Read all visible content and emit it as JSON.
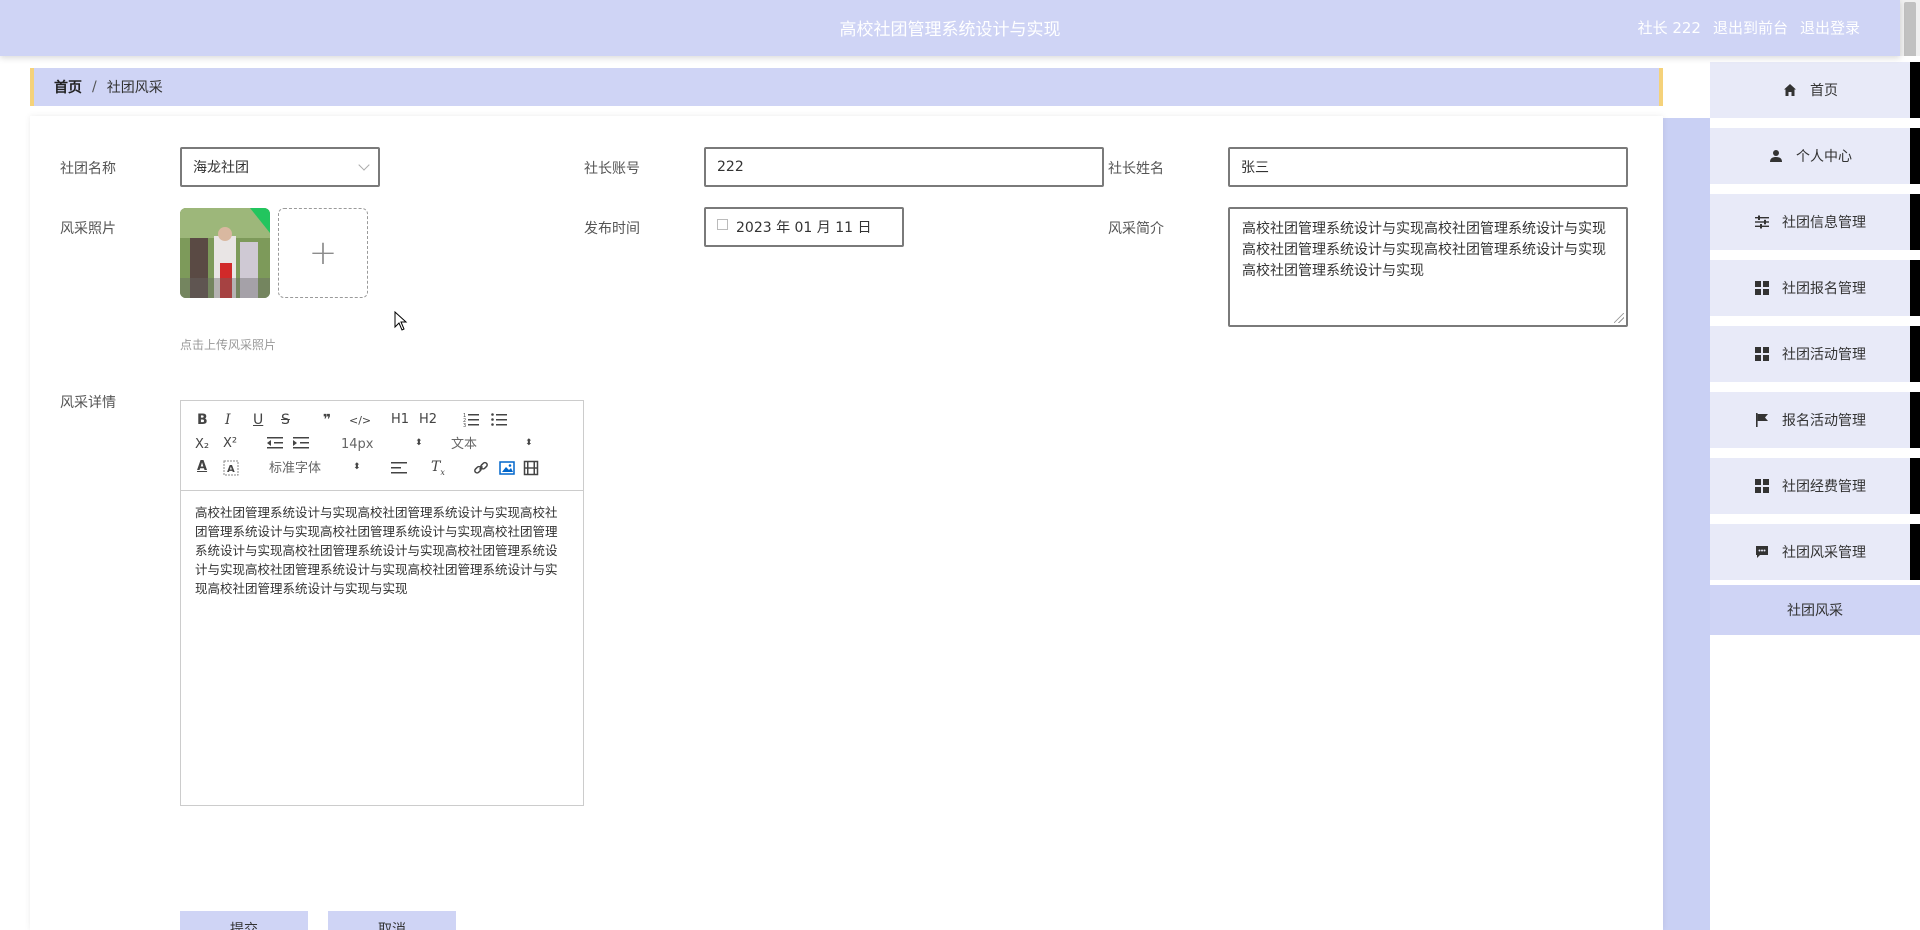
{
  "header": {
    "title": "高校社团管理系统设计与实现",
    "user_label": "社长 222",
    "back_label": "退出到前台",
    "logout_label": "退出登录"
  },
  "breadcrumb": {
    "home": "首页",
    "separator": "/",
    "current": "社团风采"
  },
  "form": {
    "club_name_label": "社团名称",
    "club_name_value": "海龙社团",
    "leader_account_label": "社长账号",
    "leader_account_value": "222",
    "leader_name_label": "社长姓名",
    "leader_name_value": "张三",
    "photo_label": "风采照片",
    "photo_hint": "点击上传风采照片",
    "publish_time_label": "发布时间",
    "publish_time_value": "2023 年 01 月 11 日",
    "intro_label": "风采简介",
    "intro_value": "高校社团管理系统设计与实现高校社团管理系统设计与实现高校社团管理系统设计与实现高校社团管理系统设计与实现高校社团管理系统设计与实现",
    "detail_label": "风采详情",
    "detail_value": "高校社团管理系统设计与实现高校社团管理系统设计与实现高校社团管理系统设计与实现高校社团管理系统设计与实现高校社团管理系统设计与实现高校社团管理系统设计与实现高校社团管理系统设计与实现高校社团管理系统设计与实现高校社团管理系统设计与实现高校社团管理系统设计与实现与实现",
    "submit_label": "提交",
    "cancel_label": "取消"
  },
  "editor_toolbar": {
    "bold": "B",
    "italic": "I",
    "underline": "U",
    "strike": "S",
    "quote": "❞",
    "code": "</>",
    "h1": "H1",
    "h2": "H2",
    "subscript": "X₂",
    "superscript": "X²",
    "size_value": "14px",
    "header_value": "文本",
    "font_value": "标准字体"
  },
  "sidebar": {
    "items": [
      {
        "label": "首页",
        "icon": "home-icon"
      },
      {
        "label": "个人中心",
        "icon": "user-icon"
      },
      {
        "label": "社团信息管理",
        "icon": "sliders-icon"
      },
      {
        "label": "社团报名管理",
        "icon": "grid-icon"
      },
      {
        "label": "社团活动管理",
        "icon": "grid-icon"
      },
      {
        "label": "报名活动管理",
        "icon": "flag-icon"
      },
      {
        "label": "社团经费管理",
        "icon": "grid-icon"
      },
      {
        "label": "社团风采管理",
        "icon": "comment-icon"
      }
    ],
    "sub_item": "社团风采"
  },
  "colors": {
    "accent": "#cfd4f5",
    "breadcrumb_border": "#f5d27a",
    "sidebar_item_bg": "#e8eaf8"
  }
}
